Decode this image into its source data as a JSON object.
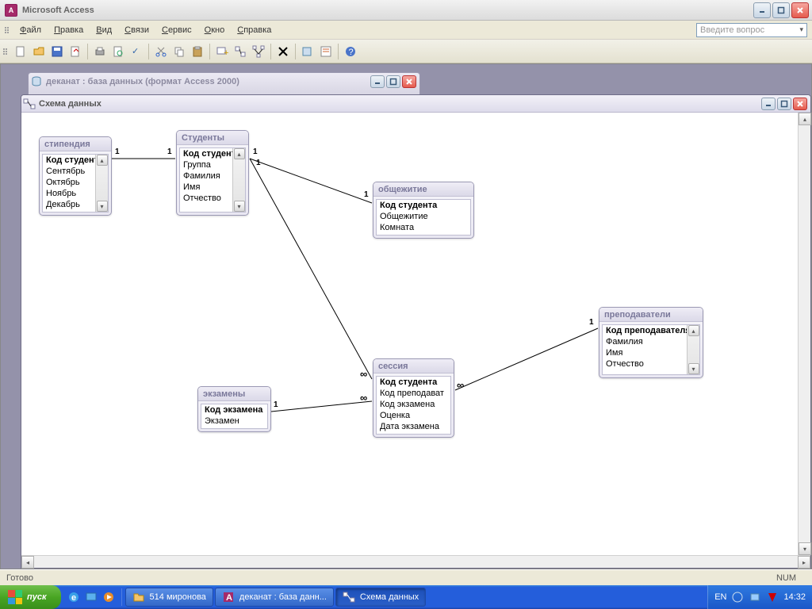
{
  "app": {
    "title": "Microsoft Access"
  },
  "menu": {
    "items": [
      "Файл",
      "Правка",
      "Вид",
      "Связи",
      "Сервис",
      "Окно",
      "Справка"
    ],
    "question_placeholder": "Введите вопрос"
  },
  "db_window": {
    "title": "деканат : база данных (формат Access 2000)"
  },
  "schema_window": {
    "title": "Схема данных"
  },
  "tables": {
    "stipendia": {
      "title": "стипендия",
      "fields": [
        "Код студент",
        "Сентябрь",
        "Октябрь",
        "Ноябрь",
        "Декабрь"
      ],
      "key": 0,
      "scroll": true
    },
    "studenty": {
      "title": "Студенты",
      "fields": [
        "Код студент",
        "Группа",
        "Фамилия",
        "Имя",
        "Отчество"
      ],
      "key": 0,
      "scroll": true
    },
    "obshezhitie": {
      "title": "общежитие",
      "fields": [
        "Код студента",
        "Общежитие",
        "Комната"
      ],
      "key": 0,
      "scroll": false
    },
    "prepodavateli": {
      "title": "преподаватели",
      "fields": [
        "Код преподавателя",
        "Фамилия",
        "Имя",
        "Отчество"
      ],
      "key": 0,
      "scroll": true
    },
    "sessia": {
      "title": "сессия",
      "fields": [
        "Код студента",
        "Код преподават",
        "Код экзамена",
        "Оценка",
        "Дата экзамена"
      ],
      "key": 0,
      "scroll": false
    },
    "ekzameny": {
      "title": "экзамены",
      "fields": [
        "Код экзамена",
        "Экзамен"
      ],
      "key": 0,
      "scroll": false
    }
  },
  "relations": [
    {
      "from_label": "1",
      "to_label": "1"
    },
    {
      "from_label": "1",
      "to_label": "1"
    },
    {
      "from_label": "1",
      "to_label": "∞"
    },
    {
      "from_label": "1",
      "to_label": "∞"
    },
    {
      "from_label": "1",
      "to_label": "∞"
    }
  ],
  "status": {
    "ready": "Готово",
    "num": "NUM"
  },
  "taskbar": {
    "start": "пуск",
    "folder": "514 миронова",
    "task1": "деканат : база данн...",
    "task2": "Схема данных",
    "lang": "EN",
    "clock": "14:32"
  }
}
